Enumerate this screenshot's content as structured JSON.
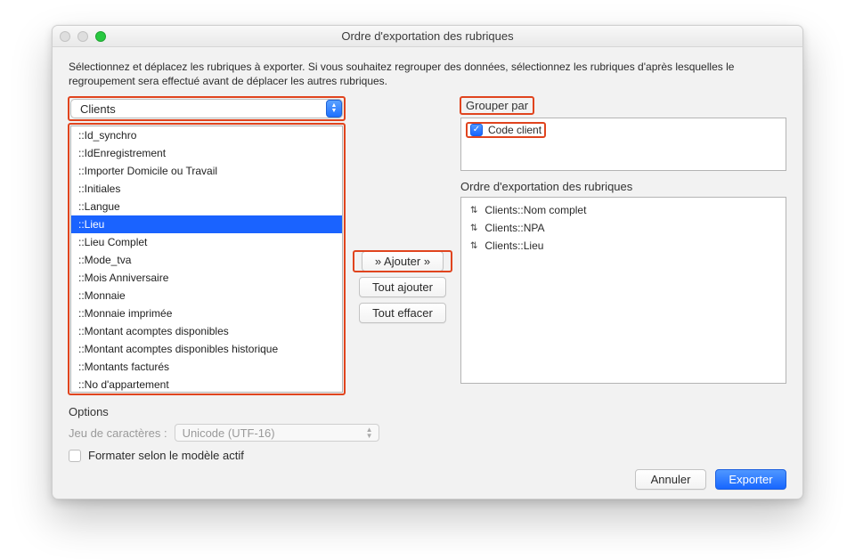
{
  "window": {
    "title": "Ordre d'exportation des rubriques"
  },
  "instructions": "Sélectionnez et déplacez les rubriques à exporter.  Si vous souhaitez regrouper des données, sélectionnez les rubriques d'après lesquelles le regroupement sera effectué avant de déplacer les autres rubriques.",
  "table_selector": {
    "value": "Clients"
  },
  "source_fields": {
    "items": [
      {
        "label": "::Id_synchro"
      },
      {
        "label": "::IdEnregistrement"
      },
      {
        "label": "::Importer Domicile ou Travail"
      },
      {
        "label": "::Initiales"
      },
      {
        "label": "::Langue"
      },
      {
        "label": "::Lieu",
        "selected": true
      },
      {
        "label": "::Lieu Complet"
      },
      {
        "label": "::Mode_tva"
      },
      {
        "label": "::Mois Anniversaire"
      },
      {
        "label": "::Monnaie"
      },
      {
        "label": "::Monnaie imprimée"
      },
      {
        "label": "::Montant acomptes disponibles"
      },
      {
        "label": "::Montant acomptes disponibles historique"
      },
      {
        "label": "::Montants facturés"
      },
      {
        "label": "::No d'appartement"
      }
    ]
  },
  "buttons": {
    "add": "» Ajouter »",
    "add_all": "Tout ajouter",
    "clear_all": "Tout effacer"
  },
  "group": {
    "header": "Grouper par",
    "items": [
      {
        "label": "Code client",
        "checked": true
      }
    ]
  },
  "export_order": {
    "header": "Ordre d'exportation des rubriques",
    "items": [
      {
        "label": "Clients::Nom complet"
      },
      {
        "label": "Clients::NPA"
      },
      {
        "label": "Clients::Lieu"
      }
    ]
  },
  "options": {
    "header": "Options",
    "charset_label": "Jeu de caractères :",
    "charset_value": "Unicode (UTF-16)",
    "format_checkbox_label": "Formater selon le modèle actif"
  },
  "footer": {
    "cancel": "Annuler",
    "export": "Exporter"
  }
}
